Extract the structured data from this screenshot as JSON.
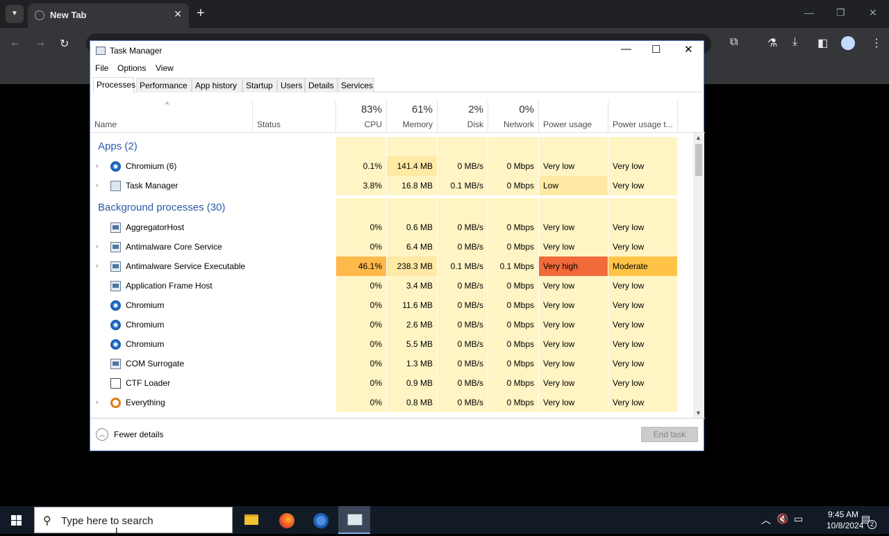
{
  "browser": {
    "tab_title": "New Tab",
    "new_tab": "+",
    "tab_close": "✕",
    "win_min": "—",
    "win_max": "❐",
    "win_close": "✕",
    "nav_back": "←",
    "nav_forward": "→",
    "nav_reload": "↻"
  },
  "task_manager": {
    "title": "Task Manager",
    "controls": {
      "minimize": "—",
      "maximize": "☐",
      "close": "✕"
    },
    "menu": [
      "File",
      "Options",
      "View"
    ],
    "tabs": [
      "Processes",
      "Performance",
      "App history",
      "Startup",
      "Users",
      "Details",
      "Services"
    ],
    "active_tab": "Processes",
    "columns": {
      "name": "Name",
      "status": "Status",
      "cpu": {
        "pct": "83%",
        "label": "CPU"
      },
      "memory": {
        "pct": "61%",
        "label": "Memory"
      },
      "disk": {
        "pct": "2%",
        "label": "Disk"
      },
      "network": {
        "pct": "0%",
        "label": "Network"
      },
      "power": "Power usage",
      "power_trend": "Power usage t..."
    },
    "groups": {
      "apps": "Apps (2)",
      "background": "Background processes (30)"
    },
    "apps": [
      {
        "name": "Chromium (6)",
        "icon": "chromium-icon",
        "expandable": true,
        "cpu": "0.1%",
        "memory": "141.4 MB",
        "disk": "0 MB/s",
        "network": "0 Mbps",
        "power": "Very low",
        "power_trend": "Very low"
      },
      {
        "name": "Task Manager",
        "icon": "task-manager-icon",
        "expandable": true,
        "cpu": "3.8%",
        "memory": "16.8 MB",
        "disk": "0.1 MB/s",
        "network": "0 Mbps",
        "power": "Low",
        "power_trend": "Very low"
      }
    ],
    "background": [
      {
        "name": "AggregatorHost",
        "icon": "app-icon",
        "expandable": false,
        "cpu": "0%",
        "memory": "0.6 MB",
        "disk": "0 MB/s",
        "network": "0 Mbps",
        "power": "Very low",
        "power_trend": "Very low"
      },
      {
        "name": "Antimalware Core Service",
        "icon": "app-icon",
        "expandable": true,
        "cpu": "0%",
        "memory": "6.4 MB",
        "disk": "0 MB/s",
        "network": "0 Mbps",
        "power": "Very low",
        "power_trend": "Very low"
      },
      {
        "name": "Antimalware Service Executable",
        "icon": "app-icon",
        "expandable": true,
        "cpu": "46.1%",
        "memory": "238.3 MB",
        "disk": "0.1 MB/s",
        "network": "0.1 Mbps",
        "power": "Very high",
        "power_trend": "Moderate"
      },
      {
        "name": "Application Frame Host",
        "icon": "app-icon",
        "expandable": false,
        "cpu": "0%",
        "memory": "3.4 MB",
        "disk": "0 MB/s",
        "network": "0 Mbps",
        "power": "Very low",
        "power_trend": "Very low"
      },
      {
        "name": "Chromium",
        "icon": "chromium-icon",
        "expandable": false,
        "cpu": "0%",
        "memory": "11.6 MB",
        "disk": "0 MB/s",
        "network": "0 Mbps",
        "power": "Very low",
        "power_trend": "Very low"
      },
      {
        "name": "Chromium",
        "icon": "chromium-icon",
        "expandable": false,
        "cpu": "0%",
        "memory": "2.6 MB",
        "disk": "0 MB/s",
        "network": "0 Mbps",
        "power": "Very low",
        "power_trend": "Very low"
      },
      {
        "name": "Chromium",
        "icon": "chromium-icon",
        "expandable": false,
        "cpu": "0%",
        "memory": "5.5 MB",
        "disk": "0 MB/s",
        "network": "0 Mbps",
        "power": "Very low",
        "power_trend": "Very low"
      },
      {
        "name": "COM Surrogate",
        "icon": "app-icon",
        "expandable": false,
        "cpu": "0%",
        "memory": "1.3 MB",
        "disk": "0 MB/s",
        "network": "0 Mbps",
        "power": "Very low",
        "power_trend": "Very low"
      },
      {
        "name": "CTF Loader",
        "icon": "ctf-loader-icon",
        "expandable": false,
        "cpu": "0%",
        "memory": "0.9 MB",
        "disk": "0 MB/s",
        "network": "0 Mbps",
        "power": "Very low",
        "power_trend": "Very low"
      },
      {
        "name": "Everything",
        "icon": "everything-search-icon",
        "expandable": true,
        "cpu": "0%",
        "memory": "0.8 MB",
        "disk": "0 MB/s",
        "network": "0 Mbps",
        "power": "Very low",
        "power_trend": "Very low"
      }
    ],
    "footer": {
      "fewer_details": "Fewer details",
      "end_task": "End task"
    }
  },
  "taskbar": {
    "search_placeholder": "Type here to search",
    "time": "9:45 AM",
    "date": "10/8/2024",
    "notification_count": "2"
  },
  "colors": {
    "heat_light": "#fff4c4",
    "heat_mid": "#ffe9a3",
    "heat_high": "#ffb84a",
    "power_very_high": "#f06a3a",
    "power_moderate": "#ffc347",
    "group_text": "#2a5aa8"
  }
}
